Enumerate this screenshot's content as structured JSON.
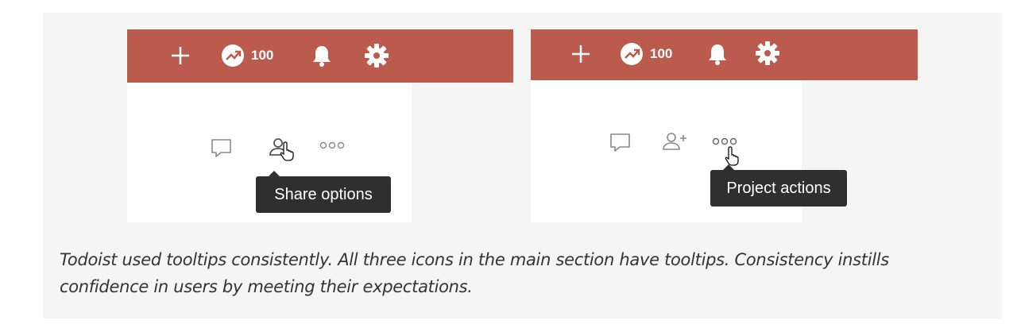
{
  "left_panel": {
    "karma_count": "100",
    "tooltip": "Share options"
  },
  "right_panel": {
    "karma_count": "100",
    "tooltip": "Project actions"
  },
  "caption": "Todoist used tooltips consistently. All three icons in the main section have tooltips. Consistency instills confidence in users by meeting their expectations.",
  "colors": {
    "topbar": "#bb5b4d",
    "tooltip_bg": "#2f2f2f",
    "figure_bg": "#f5f5f5"
  },
  "icons": [
    "plus-icon",
    "karma-icon",
    "bell-icon",
    "gear-icon",
    "comment-icon",
    "share-icon",
    "more-icon",
    "pointer-cursor-icon"
  ]
}
